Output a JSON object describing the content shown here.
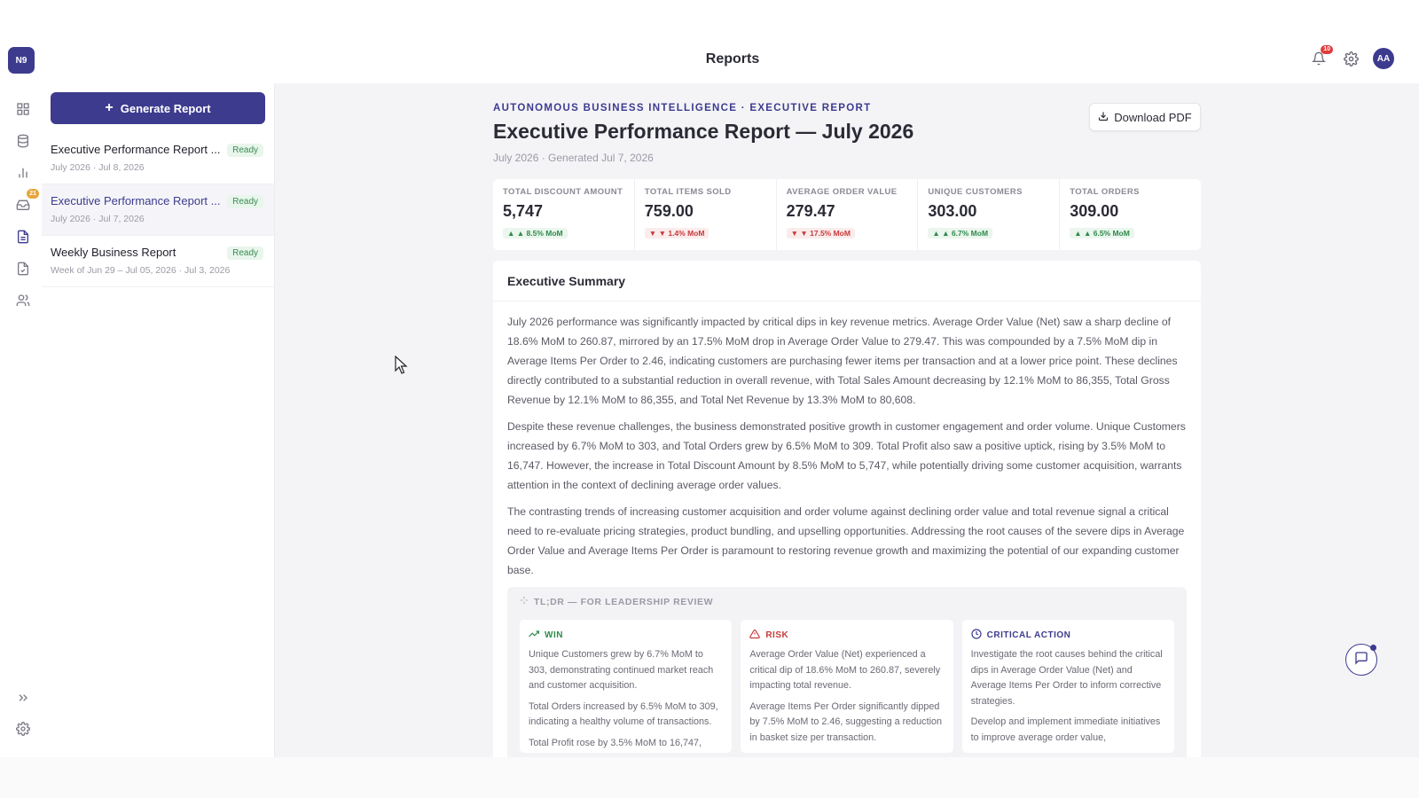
{
  "app": {
    "logo_text": "N9",
    "page_title": "Reports",
    "notifications_count": "10",
    "avatar_initials": "AA",
    "accent_color": "#3d3b8e"
  },
  "rail": {
    "items": [
      {
        "icon": "grid-icon"
      },
      {
        "icon": "database-icon"
      },
      {
        "icon": "bar-chart-icon"
      },
      {
        "icon": "inbox-icon",
        "badge": "21"
      },
      {
        "icon": "document-icon",
        "active": true
      },
      {
        "icon": "file-check-icon"
      },
      {
        "icon": "users-icon"
      }
    ],
    "bottom": [
      {
        "icon": "expand-icon"
      },
      {
        "icon": "settings-icon"
      }
    ]
  },
  "sidebar": {
    "generate_label": "Generate Report",
    "reports": [
      {
        "name": "Executive Performance Report ...",
        "status": "Ready",
        "meta": "July 2026 · Jul 8, 2026"
      },
      {
        "name": "Executive Performance Report ...",
        "status": "Ready",
        "meta": "July 2026 · Jul 7, 2026"
      },
      {
        "name": "Weekly Business Report",
        "status": "Ready",
        "meta": "Week of Jun 29 – Jul 05, 2026 · Jul 3, 2026"
      }
    ]
  },
  "report": {
    "eyebrow": "AUTONOMOUS BUSINESS INTELLIGENCE · EXECUTIVE REPORT",
    "title": "Executive Performance Report — July 2026",
    "subtitle": "July 2026 · Generated Jul 7, 2026",
    "download_label": "Download PDF",
    "kpis": [
      {
        "label": "TOTAL DISCOUNT AMOUNT",
        "value": "5,747",
        "delta": "▲ ▲ 8.5% MoM",
        "direction": "up"
      },
      {
        "label": "TOTAL ITEMS SOLD",
        "value": "759.00",
        "delta": "▼ ▼ 1.4% MoM",
        "direction": "down"
      },
      {
        "label": "AVERAGE ORDER VALUE",
        "value": "279.47",
        "delta": "▼ ▼ 17.5% MoM",
        "direction": "down"
      },
      {
        "label": "UNIQUE CUSTOMERS",
        "value": "303.00",
        "delta": "▲ ▲ 6.7% MoM",
        "direction": "up"
      },
      {
        "label": "TOTAL ORDERS",
        "value": "309.00",
        "delta": "▲ ▲ 6.5% MoM",
        "direction": "up"
      }
    ],
    "summary": {
      "heading": "Executive Summary",
      "paragraphs": [
        "July 2026 performance was significantly impacted by critical dips in key revenue metrics. Average Order Value (Net) saw a sharp decline of 18.6% MoM to 260.87, mirrored by an 17.5% MoM drop in Average Order Value to 279.47. This was compounded by a 7.5% MoM dip in Average Items Per Order to 2.46, indicating customers are purchasing fewer items per transaction and at a lower price point. These declines directly contributed to a substantial reduction in overall revenue, with Total Sales Amount decreasing by 12.1% MoM to 86,355, Total Gross Revenue by 12.1% MoM to 86,355, and Total Net Revenue by 13.3% MoM to 80,608.",
        "Despite these revenue challenges, the business demonstrated positive growth in customer engagement and order volume. Unique Customers increased by 6.7% MoM to 303, and Total Orders grew by 6.5% MoM to 309. Total Profit also saw a positive uptick, rising by 3.5% MoM to 16,747. However, the increase in Total Discount Amount by 8.5% MoM to 5,747, while potentially driving some customer acquisition, warrants attention in the context of declining average order values.",
        "The contrasting trends of increasing customer acquisition and order volume against declining order value and total revenue signal a critical need to re-evaluate pricing strategies, product bundling, and upselling opportunities. Addressing the root causes of the severe dips in Average Order Value and Average Items Per Order is paramount to restoring revenue growth and maximizing the potential of our expanding customer base."
      ]
    },
    "tldr": {
      "heading": "TL;DR — FOR LEADERSHIP REVIEW",
      "win": {
        "label": "WIN",
        "items": [
          "Unique Customers grew by 6.7% MoM to 303, demonstrating continued market reach and customer acquisition.",
          "Total Orders increased by 6.5% MoM to 309, indicating a healthy volume of transactions.",
          "Total Profit rose by 3.5% MoM to 16,747,"
        ]
      },
      "risk": {
        "label": "RISK",
        "items": [
          "Average Order Value (Net) experienced a critical dip of 18.6% MoM to 260.87, severely impacting total revenue.",
          "Average Items Per Order significantly dipped by 7.5% MoM to 2.46, suggesting a reduction in basket size per transaction."
        ]
      },
      "action": {
        "label": "CRITICAL ACTION",
        "items": [
          "Investigate the root causes behind the critical dips in Average Order Value (Net) and Average Items Per Order to inform corrective strategies.",
          "Develop and implement immediate initiatives to improve average order value,"
        ]
      }
    }
  }
}
